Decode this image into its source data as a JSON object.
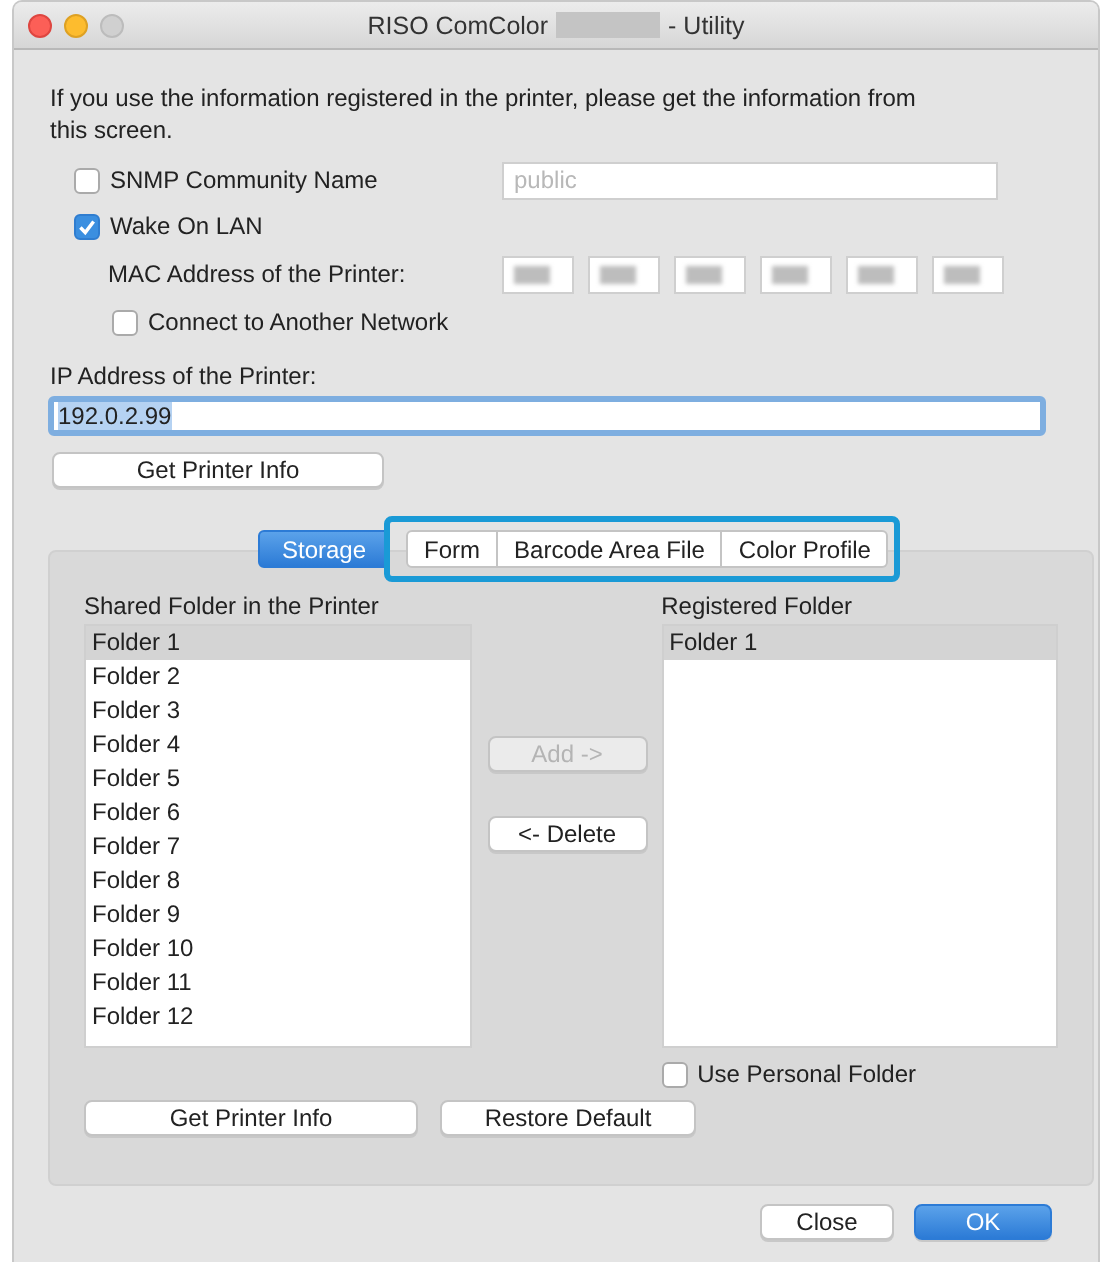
{
  "window": {
    "title_start": "RISO ComColor",
    "title_end": "- Utility"
  },
  "intro": "If you use the information registered in the printer, please get the information from this screen.",
  "snmp": {
    "label": "SNMP Community Name",
    "checked": false,
    "placeholder": "public"
  },
  "wake_on_lan": {
    "label": "Wake On LAN",
    "checked": true
  },
  "mac": {
    "label": "MAC Address of the Printer:"
  },
  "connect_network": {
    "label": "Connect to Another Network",
    "checked": false
  },
  "ip": {
    "label": "IP Address of the Printer:",
    "value": "192.0.2.99"
  },
  "get_info_button": "Get Printer Info",
  "tabs": [
    {
      "label": "Storage",
      "selected": true
    },
    {
      "label": "Form",
      "selected": false
    },
    {
      "label": "Barcode Area File",
      "selected": false
    },
    {
      "label": "Color Profile",
      "selected": false
    }
  ],
  "shared_folder": {
    "label": "Shared Folder in the Printer",
    "items": [
      {
        "label": "Folder 1",
        "selected": true
      },
      {
        "label": "Folder 2",
        "selected": false
      },
      {
        "label": "Folder 3",
        "selected": false
      },
      {
        "label": "Folder 4",
        "selected": false
      },
      {
        "label": "Folder 5",
        "selected": false
      },
      {
        "label": "Folder 6",
        "selected": false
      },
      {
        "label": "Folder 7",
        "selected": false
      },
      {
        "label": "Folder 8",
        "selected": false
      },
      {
        "label": "Folder 9",
        "selected": false
      },
      {
        "label": "Folder 10",
        "selected": false
      },
      {
        "label": "Folder 11",
        "selected": false
      },
      {
        "label": "Folder 12",
        "selected": false
      }
    ]
  },
  "add_button": {
    "label": "Add ->",
    "disabled": true
  },
  "delete_button": {
    "label": "<- Delete",
    "disabled": false
  },
  "registered_folder": {
    "label": "Registered Folder",
    "items": [
      {
        "label": "Folder 1",
        "selected": true
      }
    ]
  },
  "use_personal_folder": {
    "label": "Use Personal Folder",
    "checked": false
  },
  "panel_buttons": [
    "Get Printer Info",
    "Restore Default"
  ],
  "footer_buttons": [
    {
      "label": "Close",
      "kind": "secondary"
    },
    {
      "label": "OK",
      "kind": "primary"
    }
  ]
}
